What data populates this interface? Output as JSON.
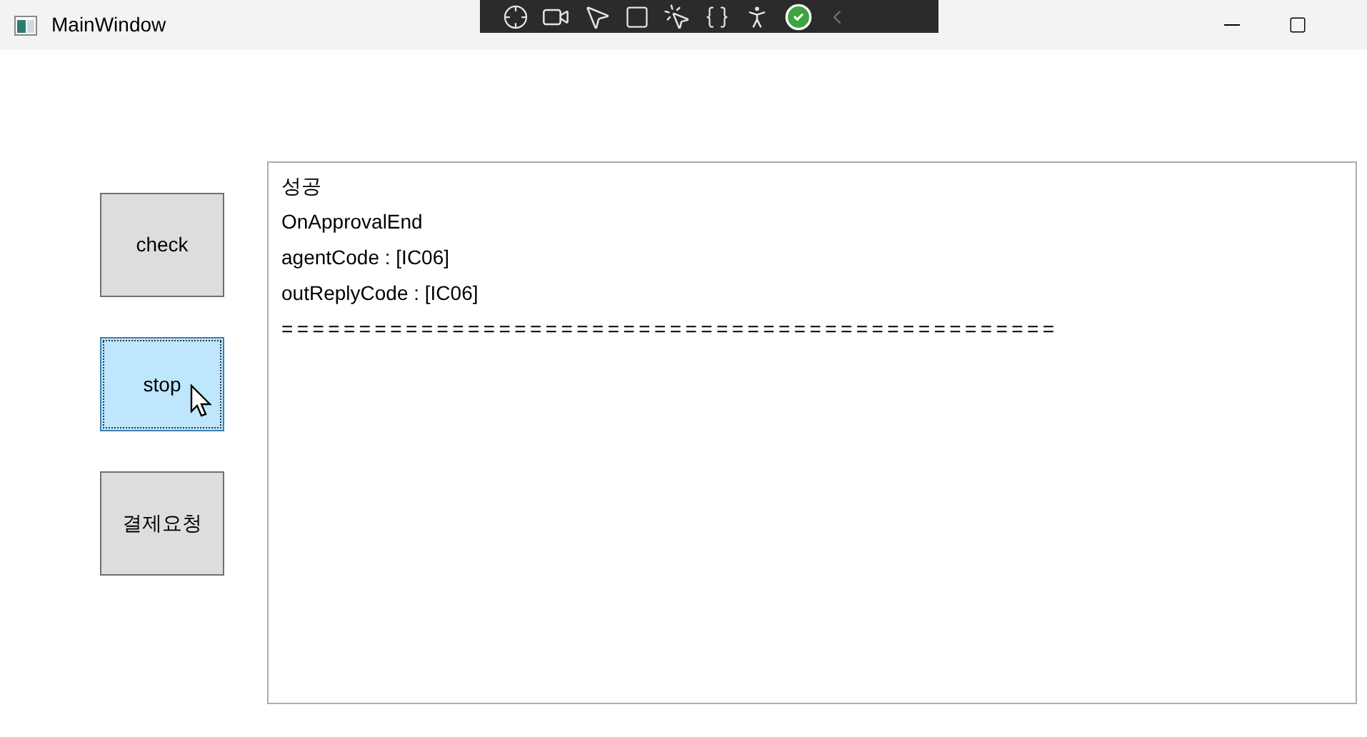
{
  "window": {
    "title": "MainWindow"
  },
  "buttons": [
    {
      "label": "check",
      "hovered": false
    },
    {
      "label": "stop",
      "hovered": true
    },
    {
      "label": "결제요청",
      "hovered": false
    }
  ],
  "log": {
    "lines": [
      "성공",
      "OnApprovalEnd",
      "agentCode : [IC06]",
      "outReplyCode : [IC06]",
      "=================================================="
    ]
  }
}
